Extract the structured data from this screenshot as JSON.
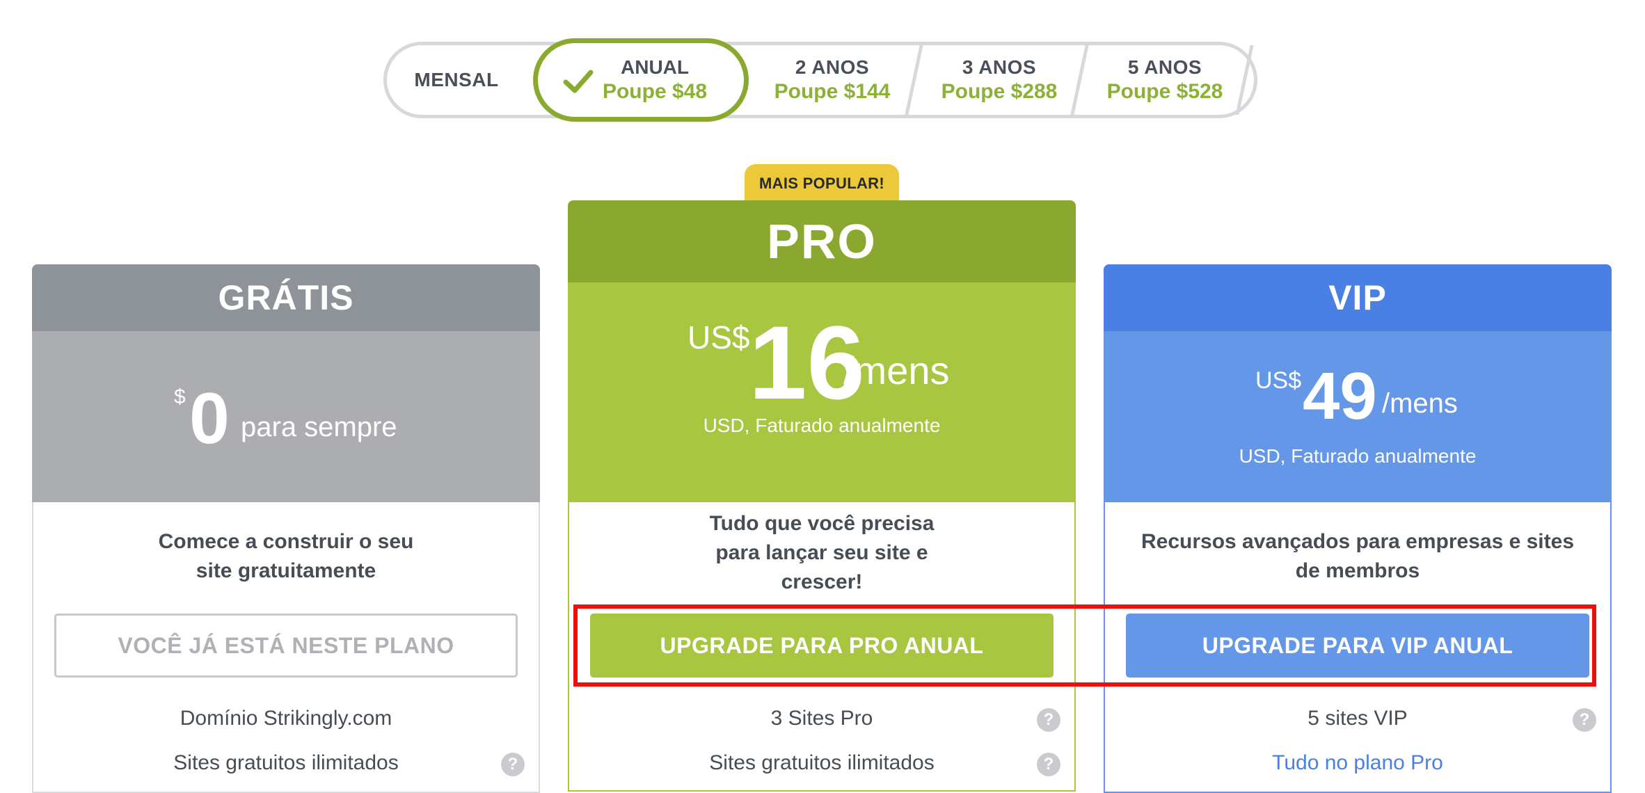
{
  "period_toggle": {
    "options": [
      {
        "label": "MENSAL",
        "savings": ""
      },
      {
        "label": "ANUAL",
        "savings": "Poupe $48"
      },
      {
        "label": "2 ANOS",
        "savings": "Poupe $144"
      },
      {
        "label": "3 ANOS",
        "savings": "Poupe $288"
      },
      {
        "label": "5 ANOS",
        "savings": "Poupe $528"
      }
    ],
    "selected": "ANUAL",
    "accent_color": "#8aaa2f",
    "savings_color": "#8cb136"
  },
  "badge": {
    "label": "MAIS POPULAR!",
    "color": "#ecc93a"
  },
  "plans": {
    "free": {
      "name": "GRÁTIS",
      "currency": "$",
      "amount": "0",
      "period": "para sempre",
      "description": [
        "Comece a construir o seu",
        "site gratuitamente"
      ],
      "button": "VOCÊ JÁ ESTÁ NESTE PLANO",
      "features": [
        "Domínio Strikingly.com",
        "Sites gratuitos ilimitados"
      ],
      "header_color": "#8e9299",
      "price_color": "#abadb1"
    },
    "pro": {
      "name": "PRO",
      "currency": "US$",
      "amount": "16",
      "period": "/mens",
      "billing": "USD, Faturado anualmente",
      "description": [
        "Tudo que você precisa",
        "para lançar seu site e",
        "crescer!"
      ],
      "button": "UPGRADE PARA PRO ANUAL",
      "features": [
        "3 Sites Pro",
        "Sites gratuitos ilimitados"
      ],
      "header_color": "#8aa82f",
      "price_color": "#a9c641"
    },
    "vip": {
      "name": "VIP",
      "currency": "US$",
      "amount": "49",
      "period": "/mens",
      "billing": "USD, Faturado anualmente",
      "description": [
        "Recursos avançados para empresas e sites",
        "de membros"
      ],
      "button": "UPGRADE PARA VIP ANUAL",
      "features": [
        "5 sites VIP",
        "Tudo no plano Pro"
      ],
      "header_color": "#4a7fe3",
      "price_color": "#6497e8"
    }
  },
  "icons": {
    "help": "question-circle-icon",
    "selected": "checkmark-icon"
  },
  "highlight_color": "#f20d0d"
}
